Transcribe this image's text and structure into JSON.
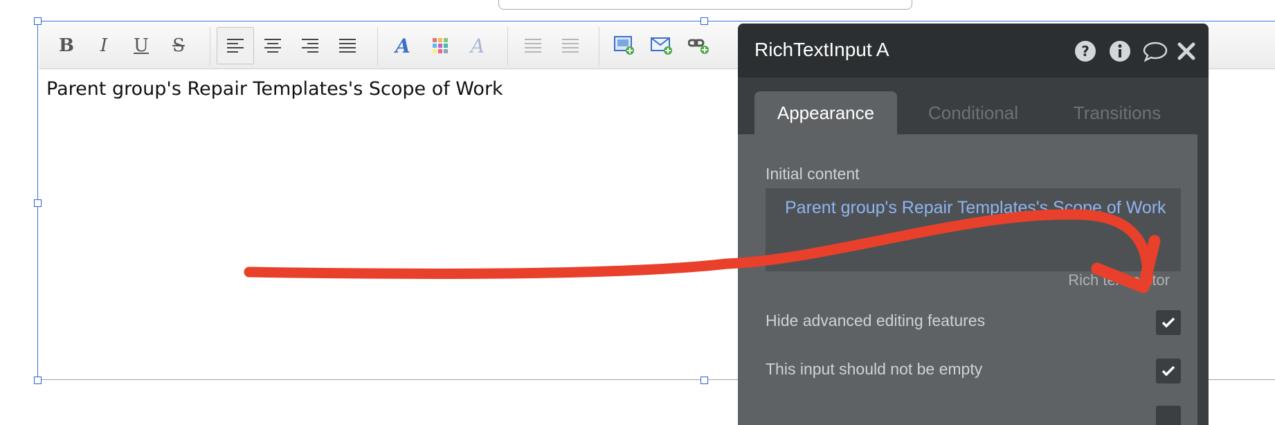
{
  "editor": {
    "content": "Parent group's Repair Templates's Scope of Work",
    "toolbar": {
      "bold": "B",
      "italic": "I",
      "underline": "U",
      "strike": "S"
    }
  },
  "panel": {
    "title": "RichTextInput A",
    "tabs": [
      {
        "label": "Appearance",
        "active": true
      },
      {
        "label": "Conditional",
        "active": false
      },
      {
        "label": "Transitions",
        "active": false
      }
    ],
    "initial_content_label": "Initial content",
    "initial_content_value": "Parent group's Repair Templates's Scope of Work",
    "editor_label": "Rich text editor",
    "options": [
      {
        "label": "Hide advanced editing features",
        "checked": true
      },
      {
        "label": "This input should not be empty",
        "checked": true
      }
    ]
  },
  "colors": {
    "annotation_arrow": "#e8402a",
    "link_blue": "#8fb4f0",
    "panel_bg": "#5f6264",
    "panel_header": "#2b2f31"
  }
}
